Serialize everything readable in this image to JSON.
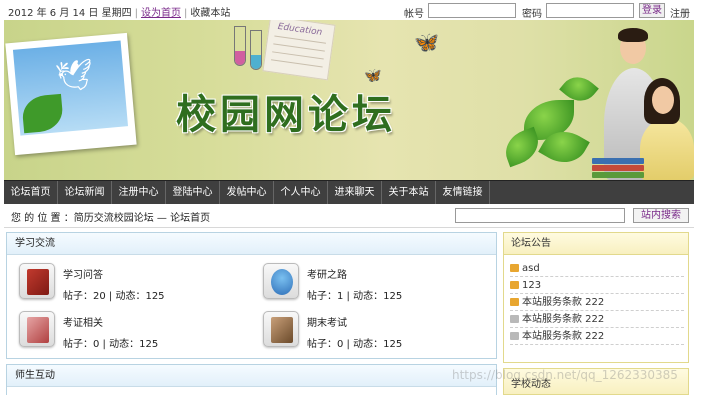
{
  "topbar": {
    "date_text": "2012 年 6 月 14 日 星期四",
    "set_home": "设为首页",
    "bookmark": "收藏本站",
    "account_label": "帐号",
    "password_label": "密码",
    "login_button": "登录",
    "register_link": "注册"
  },
  "banner": {
    "site_title": "校园网论坛",
    "paper_text": "Education"
  },
  "nav": {
    "items": [
      "论坛首页",
      "论坛新闻",
      "注册中心",
      "登陆中心",
      "发帖中心",
      "个人中心",
      "进来聊天",
      "关于本站",
      "友情链接"
    ]
  },
  "crumb": {
    "text": "您 的 位 置 ：简历交流校园论坛 — 论坛首页",
    "search_placeholder": "",
    "search_button": "站内搜索"
  },
  "study": {
    "title": "学习交流",
    "forums": [
      {
        "name": "学习问答",
        "stat": "帖子：20 | 动态：125",
        "icon": "red-book-icon"
      },
      {
        "name": "考研之路",
        "stat": "帖子：1 | 动态：125",
        "icon": "people-icon"
      },
      {
        "name": "考证相关",
        "stat": "帖子：0 | 动态：125",
        "icon": "certificate-book-icon"
      },
      {
        "name": "期末考试",
        "stat": "帖子：0 | 动态：125",
        "icon": "exam-book-icon"
      }
    ]
  },
  "teacher": {
    "title": "师生互动"
  },
  "notice": {
    "title": "论坛公告",
    "items": [
      {
        "text": "asd",
        "color": "#e8a630"
      },
      {
        "text": "123",
        "color": "#e8a630"
      },
      {
        "text": "本站服务条款  222",
        "color": "#e8a630"
      },
      {
        "text": "本站服务条款  222",
        "color": "#b9b9b9"
      },
      {
        "text": "本站服务条款  222",
        "color": "#b9b9b9"
      }
    ]
  },
  "school_news": {
    "title": "学校动态"
  },
  "watermark": "https://blog.csdn.net/qq_1262330385"
}
